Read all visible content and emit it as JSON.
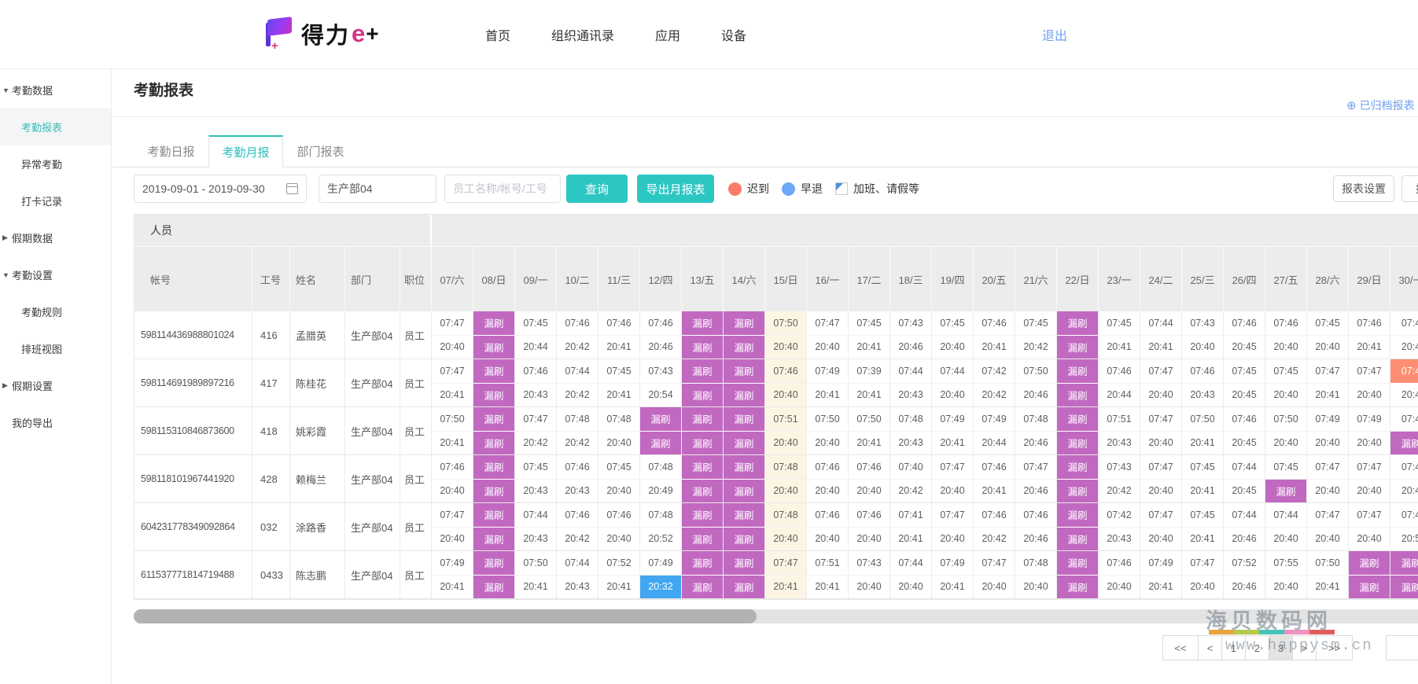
{
  "navbar": {
    "logo_text": "得力",
    "logo_e": "e",
    "logo_plus": "+",
    "items": [
      "首页",
      "组织通讯录",
      "应用",
      "设备"
    ],
    "logout": "退出"
  },
  "sidebar": {
    "items": [
      {
        "label": "考勤数据",
        "level": 0,
        "arrow": "down",
        "active": false
      },
      {
        "label": "考勤报表",
        "level": 1,
        "arrow": "none",
        "active": true
      },
      {
        "label": "异常考勤",
        "level": 1,
        "arrow": "none",
        "active": false
      },
      {
        "label": "打卡记录",
        "level": 1,
        "arrow": "none",
        "active": false
      },
      {
        "label": "假期数据",
        "level": 0,
        "arrow": "right",
        "active": false
      },
      {
        "label": "考勤设置",
        "level": 0,
        "arrow": "down",
        "active": false
      },
      {
        "label": "考勤规则",
        "level": 1,
        "arrow": "none",
        "active": false
      },
      {
        "label": "排班视图",
        "level": 1,
        "arrow": "none",
        "active": false
      },
      {
        "label": "假期设置",
        "level": 0,
        "arrow": "right",
        "active": false
      },
      {
        "label": "我的导出",
        "level": 0,
        "arrow": "none",
        "active": false
      }
    ]
  },
  "page": {
    "title": "考勤报表",
    "archived_link": "已归档报表"
  },
  "tabs": [
    {
      "label": "考勤日报",
      "active": false
    },
    {
      "label": "考勤月报",
      "active": true
    },
    {
      "label": "部门报表",
      "active": false
    }
  ],
  "filters": {
    "date_range": "2019-09-01 - 2019-09-30",
    "department": "生产部04",
    "search_placeholder": "员工名称/帐号/工号",
    "query_button": "查询",
    "export_button": "导出月报表",
    "settings_button": "报表设置",
    "partial_button": "报"
  },
  "legend": [
    {
      "label": "迟到",
      "type": "dot",
      "color": "#fa7b6c"
    },
    {
      "label": "早退",
      "type": "dot",
      "color": "#6fa8f8"
    },
    {
      "label": "加班、请假等",
      "type": "corner",
      "color": "#4a90e2"
    }
  ],
  "table": {
    "group_header": "人员",
    "info_columns": [
      "帐号",
      "工号",
      "姓名",
      "部门",
      "职位"
    ],
    "date_columns": [
      "07/六",
      "08/日",
      "09/一",
      "10/二",
      "11/三",
      "12/四",
      "13/五",
      "14/六",
      "15/日",
      "16/一",
      "17/二",
      "18/三",
      "19/四",
      "20/五",
      "21/六",
      "22/日",
      "23/一",
      "24/二",
      "25/三",
      "26/四",
      "27/五",
      "28/六",
      "29/日",
      "30/一"
    ],
    "highlight_column": 8,
    "cell_markers": {
      "漏刷": "missed-swipe",
      "!": "迟到-late",
      "~": "早退-early-leave"
    },
    "rows": [
      {
        "account": "598114436988801024",
        "emp_no": "416",
        "name": "孟腊英",
        "dept": "生产部04",
        "position": "员工",
        "checkin": [
          "07:47",
          "漏刷",
          "07:45",
          "07:46",
          "07:46",
          "07:46",
          "漏刷",
          "漏刷",
          "07:50",
          "07:47",
          "07:45",
          "07:43",
          "07:45",
          "07:46",
          "07:45",
          "漏刷",
          "07:45",
          "07:44",
          "07:43",
          "07:46",
          "07:46",
          "07:45",
          "07:46",
          "07:4"
        ],
        "checkout": [
          "20:40",
          "漏刷",
          "20:44",
          "20:42",
          "20:41",
          "20:46",
          "漏刷",
          "漏刷",
          "20:40",
          "20:40",
          "20:41",
          "20:46",
          "20:40",
          "20:41",
          "20:42",
          "漏刷",
          "20:41",
          "20:41",
          "20:40",
          "20:45",
          "20:40",
          "20:40",
          "20:41",
          "20:4"
        ]
      },
      {
        "account": "598114691989897216",
        "emp_no": "417",
        "name": "陈桂花",
        "dept": "生产部04",
        "position": "员工",
        "checkin": [
          "07:47",
          "漏刷",
          "07:46",
          "07:44",
          "07:45",
          "07:43",
          "漏刷",
          "漏刷",
          "07:46",
          "07:49",
          "07:39",
          "07:44",
          "07:44",
          "07:42",
          "07:50",
          "漏刷",
          "07:46",
          "07:47",
          "07:46",
          "07:45",
          "07:45",
          "07:47",
          "07:47",
          "!07:4"
        ],
        "checkout": [
          "20:41",
          "漏刷",
          "20:43",
          "20:42",
          "20:41",
          "20:54",
          "漏刷",
          "漏刷",
          "20:40",
          "20:41",
          "20:41",
          "20:43",
          "20:40",
          "20:42",
          "20:46",
          "漏刷",
          "20:44",
          "20:40",
          "20:43",
          "20:45",
          "20:40",
          "20:41",
          "20:40",
          "20:4"
        ]
      },
      {
        "account": "598115310846873600",
        "emp_no": "418",
        "name": "姚彩霞",
        "dept": "生产部04",
        "position": "员工",
        "checkin": [
          "07:50",
          "漏刷",
          "07:47",
          "07:48",
          "07:48",
          "漏刷",
          "漏刷",
          "漏刷",
          "07:51",
          "07:50",
          "07:50",
          "07:48",
          "07:49",
          "07:49",
          "07:48",
          "漏刷",
          "07:51",
          "07:47",
          "07:50",
          "07:46",
          "07:50",
          "07:49",
          "07:49",
          "07:4"
        ],
        "checkout": [
          "20:41",
          "漏刷",
          "20:42",
          "20:42",
          "20:40",
          "漏刷",
          "漏刷",
          "漏刷",
          "20:40",
          "20:40",
          "20:41",
          "20:43",
          "20:41",
          "20:44",
          "20:46",
          "漏刷",
          "20:43",
          "20:40",
          "20:41",
          "20:45",
          "20:40",
          "20:40",
          "20:40",
          "漏刷"
        ]
      },
      {
        "account": "598118101967441920",
        "emp_no": "428",
        "name": "赖梅兰",
        "dept": "生产部04",
        "position": "员工",
        "checkin": [
          "07:46",
          "漏刷",
          "07:45",
          "07:46",
          "07:45",
          "07:48",
          "漏刷",
          "漏刷",
          "07:48",
          "07:46",
          "07:46",
          "07:40",
          "07:47",
          "07:46",
          "07:47",
          "漏刷",
          "07:43",
          "07:47",
          "07:45",
          "07:44",
          "07:45",
          "07:47",
          "07:47",
          "07:4"
        ],
        "checkout": [
          "20:40",
          "漏刷",
          "20:43",
          "20:43",
          "20:40",
          "20:49",
          "漏刷",
          "漏刷",
          "20:40",
          "20:40",
          "20:40",
          "20:42",
          "20:40",
          "20:41",
          "20:46",
          "漏刷",
          "20:42",
          "20:40",
          "20:41",
          "20:45",
          "漏刷",
          "20:40",
          "20:40",
          "20:4"
        ]
      },
      {
        "account": "604231778349092864",
        "emp_no": "032",
        "name": "涂路香",
        "dept": "生产部04",
        "position": "员工",
        "checkin": [
          "07:47",
          "漏刷",
          "07:44",
          "07:46",
          "07:46",
          "07:48",
          "漏刷",
          "漏刷",
          "07:48",
          "07:46",
          "07:46",
          "07:41",
          "07:47",
          "07:46",
          "07:46",
          "漏刷",
          "07:42",
          "07:47",
          "07:45",
          "07:44",
          "07:44",
          "07:47",
          "07:47",
          "07:4"
        ],
        "checkout": [
          "20:40",
          "漏刷",
          "20:43",
          "20:42",
          "20:40",
          "20:52",
          "漏刷",
          "漏刷",
          "20:40",
          "20:40",
          "20:40",
          "20:41",
          "20:40",
          "20:42",
          "20:46",
          "漏刷",
          "20:43",
          "20:40",
          "20:41",
          "20:46",
          "20:40",
          "20:40",
          "20:40",
          "20:5"
        ]
      },
      {
        "account": "611537771814719488",
        "emp_no": "0433",
        "name": "陈志鹏",
        "dept": "生产部04",
        "position": "员工",
        "checkin": [
          "07:49",
          "漏刷",
          "07:50",
          "07:44",
          "07:52",
          "07:49",
          "漏刷",
          "漏刷",
          "07:47",
          "07:51",
          "07:43",
          "07:44",
          "07:49",
          "07:47",
          "07:48",
          "漏刷",
          "07:46",
          "07:49",
          "07:47",
          "07:52",
          "07:55",
          "07:50",
          "漏刷",
          "漏刷"
        ],
        "checkout": [
          "20:41",
          "漏刷",
          "20:41",
          "20:43",
          "20:41",
          "~20:32",
          "漏刷",
          "漏刷",
          "20:41",
          "20:41",
          "20:40",
          "20:40",
          "20:41",
          "20:40",
          "20:40",
          "漏刷",
          "20:40",
          "20:41",
          "20:40",
          "20:46",
          "20:40",
          "20:41",
          "漏刷",
          "漏刷"
        ]
      }
    ]
  },
  "pagination": {
    "buttons": [
      "<<",
      "<",
      "1",
      "2",
      "3",
      ">",
      ">>"
    ],
    "active": "3"
  },
  "watermark": {
    "line1": "海贝数码网",
    "line2": "www.happysm.cn"
  },
  "colors": {
    "accent_teal": "#2cc7c3",
    "link_blue": "#6e9ff0",
    "missed_magenta": "#c169c1",
    "late_orange": "#ff8d73",
    "early_blue": "#42a6f0",
    "highlight_cream": "#fdf5e4",
    "header_gray": "#ececec",
    "watermark_bar": [
      "#e8a33d",
      "#b5c94d",
      "#45c4bc",
      "#f092c0",
      "#e05d5d"
    ]
  }
}
